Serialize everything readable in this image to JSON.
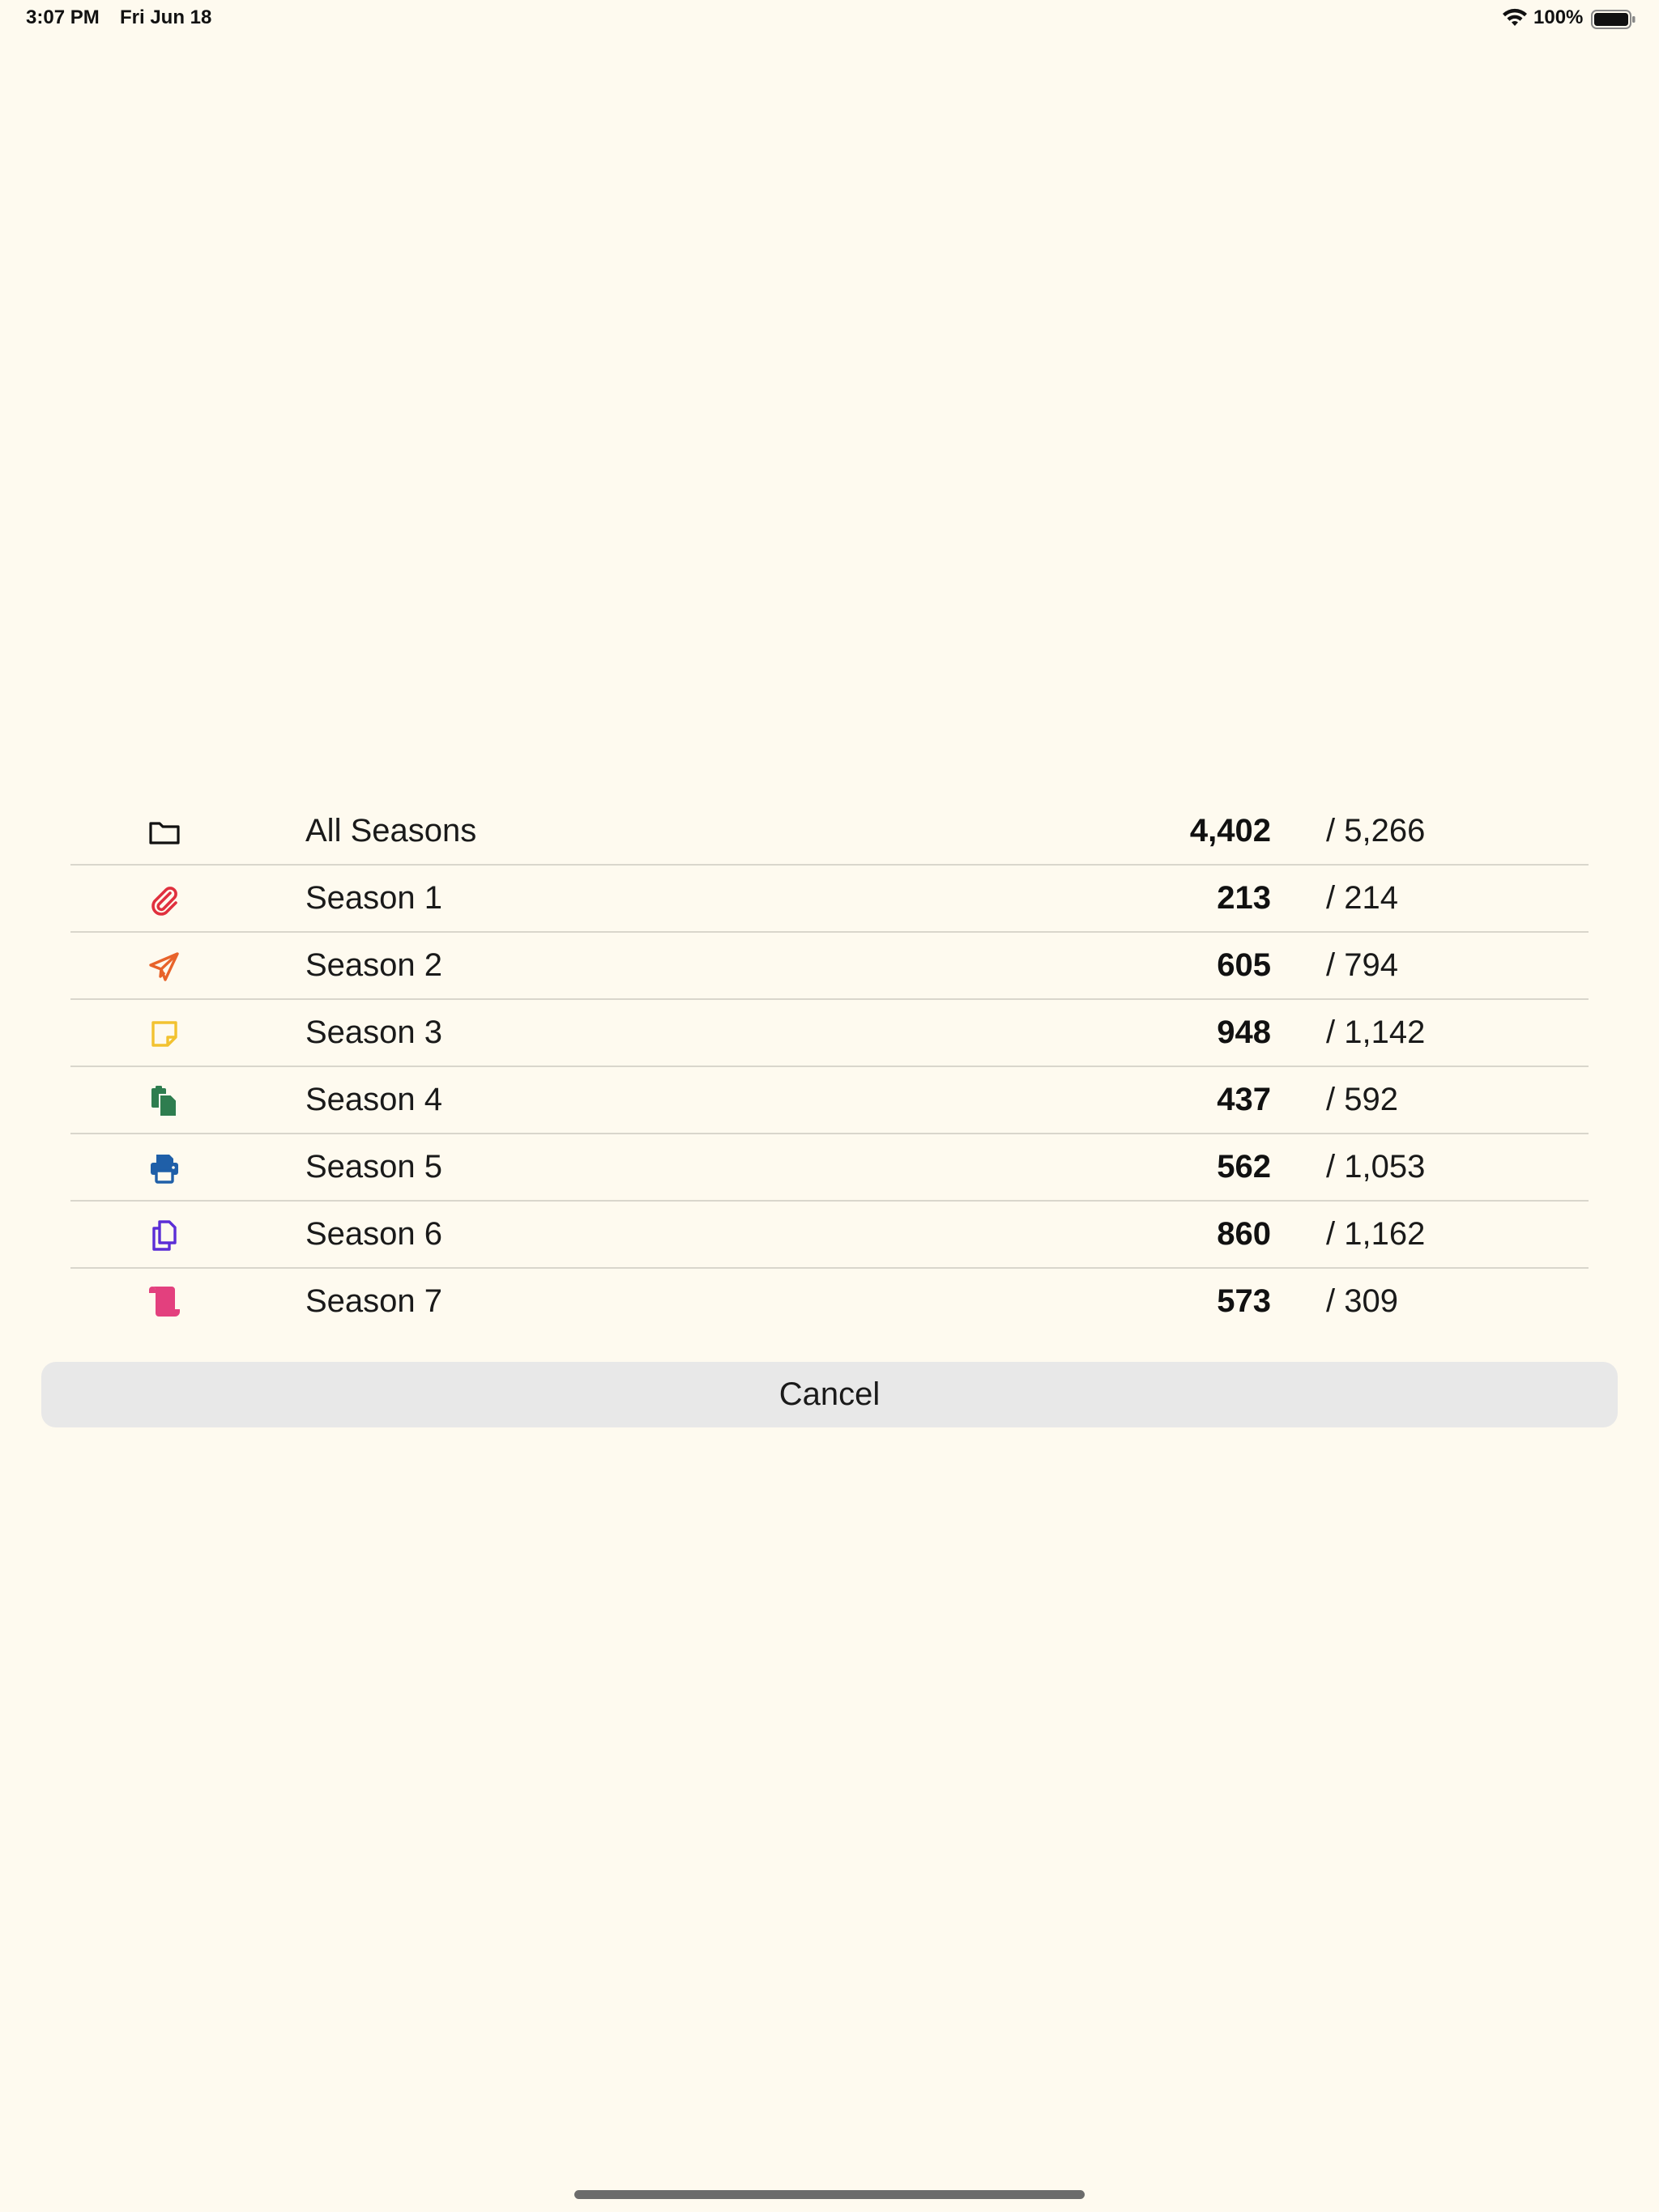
{
  "status_bar": {
    "time": "3:07 PM",
    "date": "Fri Jun 18",
    "battery_percent": "100%",
    "battery_level": 1.0,
    "wifi_icon": "wifi-icon",
    "battery_icon": "battery-icon"
  },
  "seasons": [
    {
      "label": "All Seasons",
      "count": "4,402",
      "total": "/ 5,266",
      "icon": "folder-icon",
      "color": "#111111"
    },
    {
      "label": "Season 1",
      "count": "213",
      "total": "/ 214",
      "icon": "paperclip-icon",
      "color": "#E0303E"
    },
    {
      "label": "Season 2",
      "count": "605",
      "total": "/ 794",
      "icon": "paper-plane-icon",
      "color": "#E8632A"
    },
    {
      "label": "Season 3",
      "count": "948",
      "total": "/ 1,142",
      "icon": "sticky-note-icon",
      "color": "#F2C230"
    },
    {
      "label": "Season 4",
      "count": "437",
      "total": "/ 592",
      "icon": "clipboard-copy-icon",
      "color": "#2E7D4F"
    },
    {
      "label": "Season 5",
      "count": "562",
      "total": "/ 1,053",
      "icon": "printer-icon",
      "color": "#1F5FA8"
    },
    {
      "label": "Season 6",
      "count": "860",
      "total": "/ 1,162",
      "icon": "copy-icon",
      "color": "#5B2ED6"
    },
    {
      "label": "Season 7",
      "count": "573",
      "total": "/ 309",
      "icon": "scroll-icon",
      "color": "#E3407E"
    }
  ],
  "cancel_label": "Cancel"
}
